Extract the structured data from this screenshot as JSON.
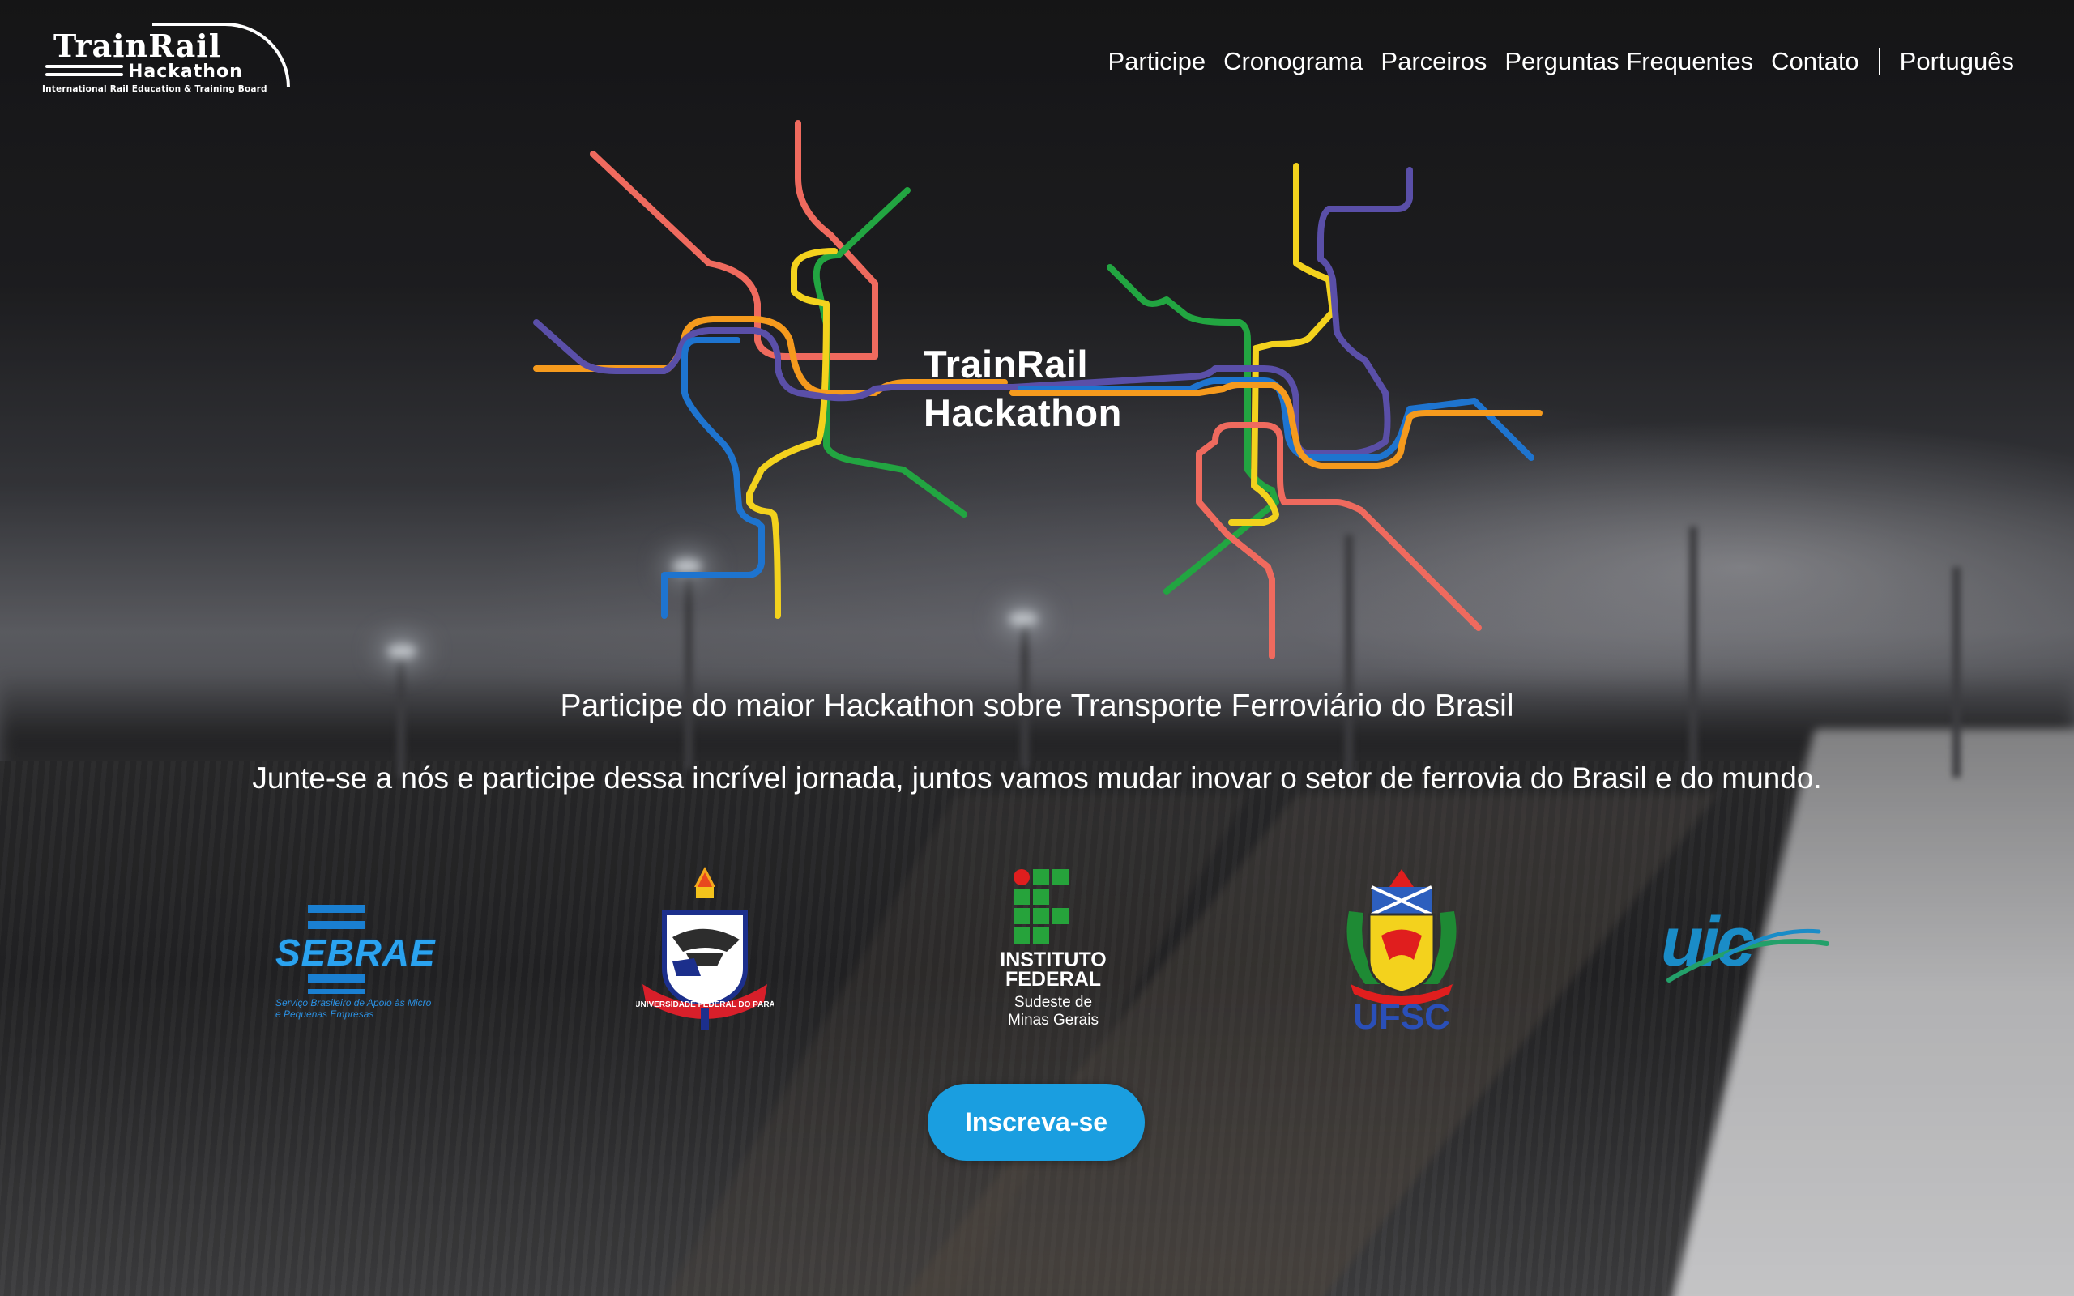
{
  "brand": {
    "logo_title": "TrainRail",
    "logo_subtitle": "Hackathon",
    "logo_tagline": "International Rail Education & Training Board"
  },
  "nav": {
    "items": [
      "Participe",
      "Cronograma",
      "Parceiros",
      "Perguntas Frequentes",
      "Contato"
    ],
    "language": "Português"
  },
  "hero": {
    "title_line1": "TrainRail",
    "title_line2": "Hackathon",
    "subtitle": "Participe do maior Hackathon sobre Transporte Ferroviário do Brasil",
    "tagline": "Junte-se a nós e participe dessa incrível jornada, juntos vamos mudar inovar o setor de ferrovia do Brasil e do mundo.",
    "line_colors": {
      "red": "#ef6a5e",
      "green": "#22a541",
      "yellow": "#f3d21d",
      "orange": "#f59a1d",
      "purple": "#5a4fa8",
      "blue": "#1e74cf"
    }
  },
  "partners": {
    "sebrae": {
      "name": "SEBRAE",
      "tagline": "Serviço Brasileiro de Apoio às Micro e Pequenas Empresas"
    },
    "ufpa": {
      "banner": "UNIVERSIDADE FEDERAL DO PARÁ"
    },
    "if": {
      "name_line1": "INSTITUTO",
      "name_line2": "FEDERAL",
      "sub_line1": "Sudeste de",
      "sub_line2": "Minas Gerais"
    },
    "ufsc": {
      "name": "UFSC"
    },
    "uic": {
      "name": "uic"
    }
  },
  "cta": {
    "label": "Inscreva-se",
    "color": "#1a9ee0"
  }
}
